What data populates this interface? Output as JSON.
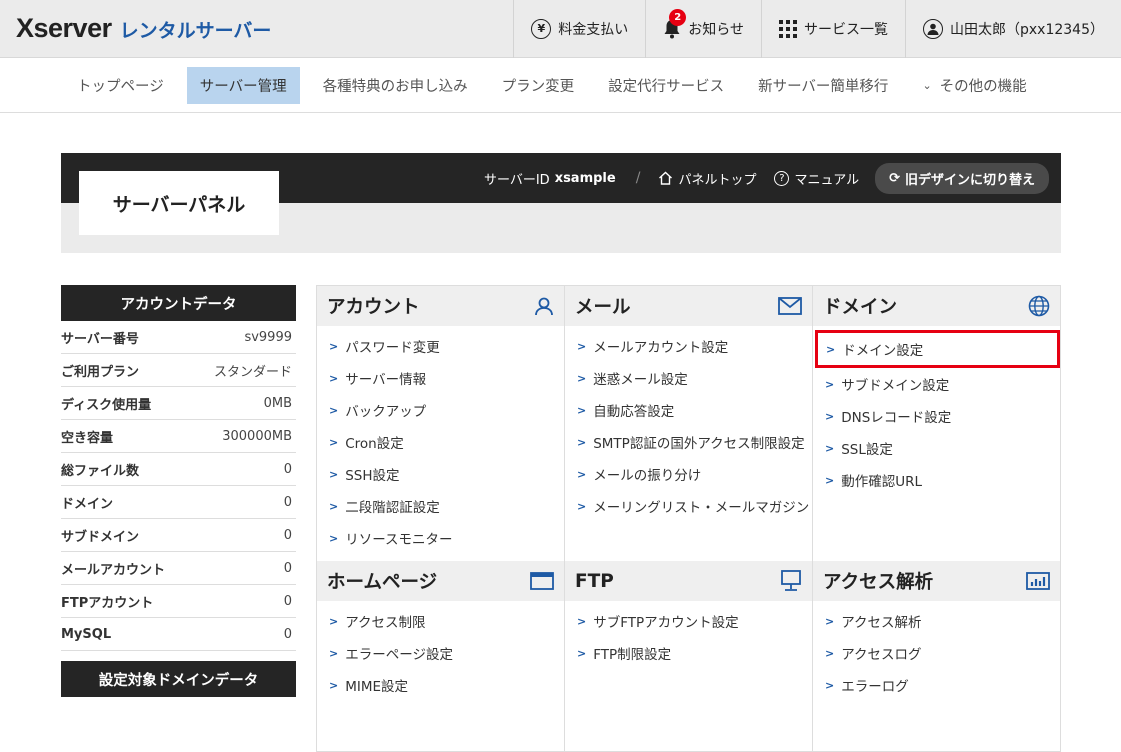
{
  "brand": {
    "logo": "Xserver",
    "sub": "レンタルサーバー"
  },
  "top": {
    "payment": "料金支払い",
    "notice": "お知らせ",
    "notice_count": "2",
    "services": "サービス一覧",
    "user": "山田太郎（pxx12345）"
  },
  "nav": [
    "トップページ",
    "サーバー管理",
    "各種特典のお申し込み",
    "プラン変更",
    "設定代行サービス",
    "新サーバー簡単移行",
    "その他の機能"
  ],
  "panel": {
    "title": "サーバーパネル",
    "server_id_label": "サーバーID",
    "server_id": "xsample",
    "panel_top": "パネルトップ",
    "manual": "マニュアル",
    "switch": "旧デザインに切り替え"
  },
  "account_data": {
    "title": "アカウントデータ",
    "rows": [
      {
        "k": "サーバー番号",
        "v": "sv9999"
      },
      {
        "k": "ご利用プラン",
        "v": "スタンダード"
      },
      {
        "k": "ディスク使用量",
        "v": "0MB"
      },
      {
        "k": "空き容量",
        "v": "300000MB"
      },
      {
        "k": "総ファイル数",
        "v": "0"
      },
      {
        "k": "ドメイン",
        "v": "0"
      },
      {
        "k": "サブドメイン",
        "v": "0"
      },
      {
        "k": "メールアカウント",
        "v": "0"
      },
      {
        "k": "FTPアカウント",
        "v": "0"
      },
      {
        "k": "MySQL",
        "v": "0"
      }
    ],
    "domain_title": "設定対象ドメインデータ"
  },
  "sections": {
    "account": {
      "title": "アカウント",
      "items": [
        "パスワード変更",
        "サーバー情報",
        "バックアップ",
        "Cron設定",
        "SSH設定",
        "二段階認証設定",
        "リソースモニター"
      ]
    },
    "mail": {
      "title": "メール",
      "items": [
        "メールアカウント設定",
        "迷惑メール設定",
        "自動応答設定",
        "SMTP認証の国外アクセス制限設定",
        "メールの振り分け",
        "メーリングリスト・メールマガジン"
      ]
    },
    "domain": {
      "title": "ドメイン",
      "items": [
        "ドメイン設定",
        "サブドメイン設定",
        "DNSレコード設定",
        "SSL設定",
        "動作確認URL"
      ]
    },
    "homepage": {
      "title": "ホームページ",
      "items": [
        "アクセス制限",
        "エラーページ設定",
        "MIME設定"
      ]
    },
    "ftp": {
      "title": "FTP",
      "items": [
        "サブFTPアカウント設定",
        "FTP制限設定"
      ]
    },
    "analytics": {
      "title": "アクセス解析",
      "items": [
        "アクセス解析",
        "アクセスログ",
        "エラーログ"
      ]
    }
  },
  "colors": {
    "accent": "#1e5aa5",
    "highlight": "#e60012",
    "dark": "#252525"
  }
}
